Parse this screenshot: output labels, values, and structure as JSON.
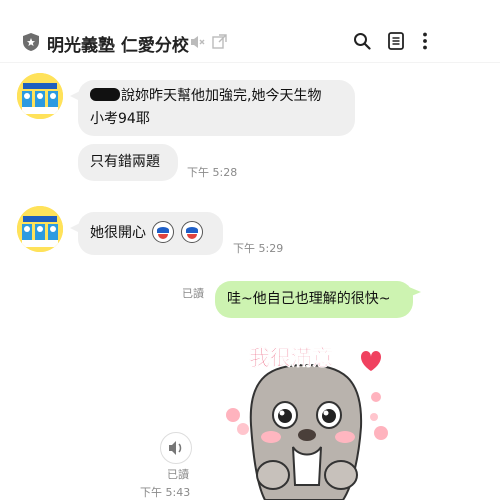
{
  "header": {
    "title": "明光義塾 仁愛分校",
    "icons": [
      "shield-icon",
      "mute-icon",
      "external-link-icon",
      "search-icon",
      "notes-icon",
      "more-icon"
    ]
  },
  "messages": [
    {
      "id": "m1",
      "sender": "other",
      "redacted_name": true,
      "text_line1": "說妳昨天幫他加強完,她今天生物",
      "text_line2": "小考94耶"
    },
    {
      "id": "m2",
      "sender": "other",
      "text": "只有錯兩題",
      "time": "下午 5:28"
    },
    {
      "id": "m3",
      "sender": "other",
      "text": "她很開心",
      "emojis": [
        "shocked-face-icon",
        "shocked-face-icon"
      ],
      "time": "下午 5:29"
    },
    {
      "id": "m4",
      "sender": "me",
      "read": "已讀",
      "text": "哇~他自己也理解的很快~"
    },
    {
      "id": "m5",
      "sender": "me",
      "type": "sticker",
      "sticker_text": "我很滿意",
      "sticker_icon": "seal-sticker-icon",
      "read": "已讀",
      "time": "下午 5:43"
    }
  ]
}
